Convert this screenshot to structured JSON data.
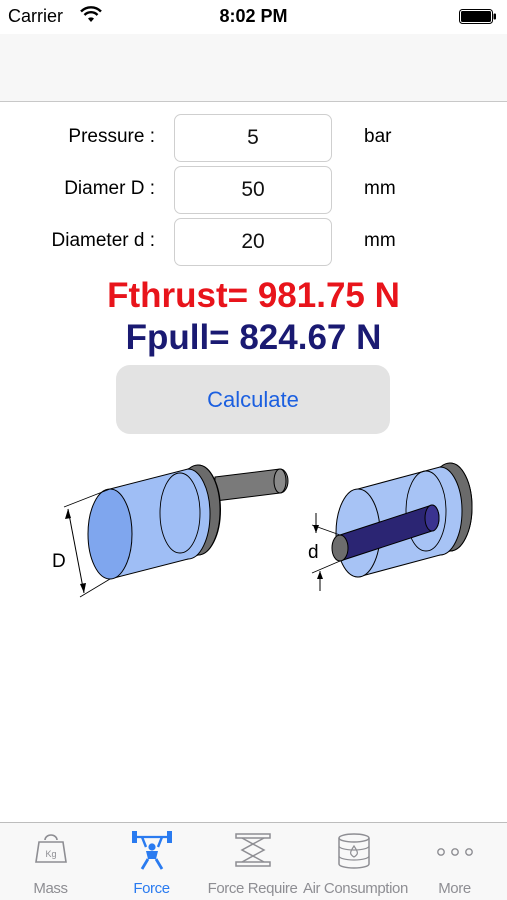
{
  "status_bar": {
    "carrier": "Carrier",
    "time": "8:02 PM"
  },
  "form": {
    "pressure": {
      "label": "Pressure :",
      "value": "5",
      "unit": "bar"
    },
    "diameter_D": {
      "label": "Diamer D :",
      "value": "50",
      "unit": "mm"
    },
    "diameter_d": {
      "label": "Diameter d :",
      "value": "20",
      "unit": "mm"
    }
  },
  "results": {
    "thrust": "Fthrust= 981.75 N",
    "pull": "Fpull= 824.67 N"
  },
  "calculate_label": "Calculate",
  "diagram": {
    "label_D": "D",
    "label_d": "d"
  },
  "tabs": [
    {
      "label": "Mass",
      "icon": "kg-weight-icon",
      "kg_text": "Kg"
    },
    {
      "label": "Force",
      "icon": "weightlifter-icon"
    },
    {
      "label": "Force Require",
      "icon": "scissor-lift-icon"
    },
    {
      "label": "Air Consumption",
      "icon": "oil-barrel-icon"
    },
    {
      "label": "More",
      "icon": "more-dots-icon"
    }
  ],
  "colors": {
    "thrust": "#e8141b",
    "pull": "#1a1a72",
    "accent": "#2a7bf0",
    "button_text": "#1b5fe0"
  }
}
